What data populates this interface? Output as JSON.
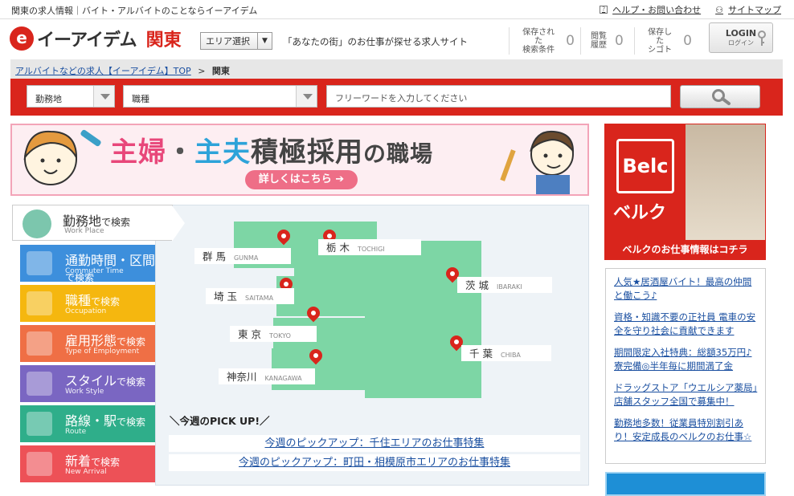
{
  "top": {
    "tagline": "関東の求人情報｜バイト・アルバイトのことならイーアイデム",
    "help_link": "ヘルプ・お問い合わせ",
    "sitemap_link": "サイトマップ"
  },
  "header": {
    "logo_mark": "e",
    "logo_name": "イーアイデム",
    "region": "関東",
    "area_select": "エリア選択",
    "catch": "「あなたの街」のお仕事が探せる求人サイト",
    "saved_conditions": {
      "label1": "保存された",
      "label2": "検索条件",
      "count": "0"
    },
    "history": {
      "label1": "閲覧",
      "label2": "履歴",
      "count": "0"
    },
    "saved_jobs": {
      "label1": "保存した",
      "label2": "シゴト",
      "count": "0"
    },
    "login": "LOGIN",
    "login_sub": "ログイン"
  },
  "breadcrumb": {
    "top": "アルバイトなどの求人【イーアイデム】TOP",
    "sep": ">",
    "current": "関東"
  },
  "search": {
    "location_select": "勤務地",
    "job_select": "職種",
    "freeword_placeholder": "フリーワードを入力してください"
  },
  "banner": {
    "title_a": "主婦",
    "title_dot": "・",
    "title_b": "主夫",
    "title_c": "積極採用",
    "title_d": "の職場",
    "button": "詳しくはこちら ➔"
  },
  "side_ad": {
    "logo": "Belc",
    "logo_jp": "ベルク",
    "caption": "ベルクのお仕事情報はコチラ"
  },
  "side_links": [
    "人気★居酒屋バイト！最高の仲間と働こう♪",
    "資格・知識不要の正社員 電車の安全を守り社会に貢献できます",
    "期間限定入社特典：総額35万円♪寮完備◎半年毎に期間満了金",
    "ドラッグストア「ウエルシア薬局」店舗スタッフ全国で募集中！",
    "勤務地多数！従業員特別割引あり！安定成長のベルクのお仕事☆"
  ],
  "nav": {
    "top": {
      "label": "勤務地",
      "suffix": "で検索",
      "sub": "Work Place"
    },
    "items": [
      {
        "label": "通勤時間・区間",
        "suffix": "で検索",
        "sub": "Commuter Time",
        "color": "#3d8fdc"
      },
      {
        "label": "職種",
        "suffix": "で検索",
        "sub": "Occupation",
        "color": "#f5b70f"
      },
      {
        "label": "雇用形態",
        "suffix": "で検索",
        "sub": "Type of Employment",
        "color": "#ef6f45"
      },
      {
        "label": "スタイル",
        "suffix": "で検索",
        "sub": "Work Style",
        "color": "#7a66c2"
      },
      {
        "label": "路線・駅",
        "suffix": "で検索",
        "sub": "Route",
        "color": "#2fae8a"
      },
      {
        "label": "新着",
        "suffix": "で検索",
        "sub": "New Arrival",
        "color": "#ed5157"
      }
    ]
  },
  "map": {
    "gunma": {
      "jp": "群 馬",
      "en": "GUNMA"
    },
    "tochigi": {
      "jp": "栃 木",
      "en": "TOCHIGI"
    },
    "saitama": {
      "jp": "埼 玉",
      "en": "SAITAMA"
    },
    "ibaraki": {
      "jp": "茨 城",
      "en": "IBARAKI"
    },
    "tokyo": {
      "jp": "東 京",
      "en": "TOKYO"
    },
    "chiba": {
      "jp": "千 葉",
      "en": "CHIBA"
    },
    "kanagawa": {
      "jp": "神奈川",
      "en": "KANAGAWA"
    }
  },
  "pickup": {
    "heading": "＼今週のPICK UP!／",
    "links": [
      "今週のピックアップ：千住エリアのお仕事特集",
      "今週のピックアップ：町田・相模原市エリアのお仕事特集"
    ]
  },
  "colors": {
    "brand": "#d9251c",
    "map_green": "#7dd6a5",
    "link": "#1a4fa0"
  }
}
